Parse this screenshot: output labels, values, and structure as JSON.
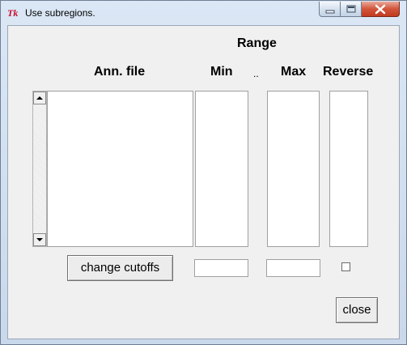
{
  "window": {
    "title": "Use subregions."
  },
  "headers": {
    "range": "Range",
    "ann_file": "Ann. file",
    "min": "Min",
    "separator": "..",
    "max": "Max",
    "reverse": "Reverse"
  },
  "inputs": {
    "min_value": "",
    "max_value": "",
    "reverse_checked": false
  },
  "buttons": {
    "change_cutoffs": "change cutoffs",
    "close": "close"
  },
  "icons": {
    "app": "tk-feather-icon",
    "minimize": "minimize-icon",
    "maximize": "maximize-icon",
    "close": "close-icon",
    "scroll_up": "arrow-up-icon",
    "scroll_down": "arrow-down-icon"
  },
  "colors": {
    "close_button": "#c23a1e",
    "tk_logo": "#c8102e"
  }
}
